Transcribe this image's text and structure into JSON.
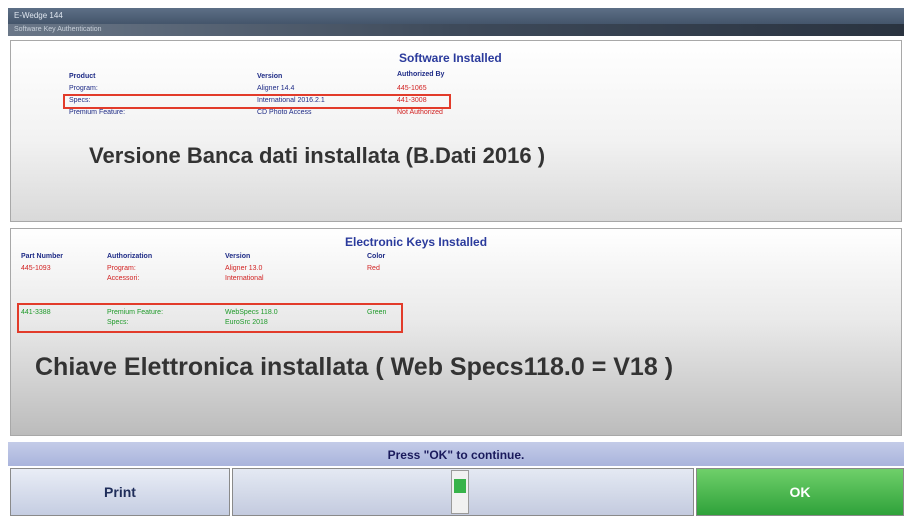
{
  "window": {
    "title": "E-Wedge 144",
    "subtitle": "Software Key Authentication"
  },
  "software": {
    "section_title": "Software Installed",
    "headers": {
      "product": "Product",
      "version": "Version",
      "authorized_by": "Authorized By"
    },
    "rows": [
      {
        "product": "Program:",
        "version": "Aligner 14.4",
        "authorized_by": "445-1065"
      },
      {
        "product": "Specs:",
        "version": "International 2016.2.1",
        "authorized_by": "441-3008"
      },
      {
        "product": "Premium Feature:",
        "version": "CD Photo Access",
        "authorized_by": "Not Authorized"
      }
    ]
  },
  "annotation_db": "Versione  Banca dati installata (B.Dati 2016 )",
  "keys": {
    "section_title": "Electronic Keys Installed",
    "headers": {
      "part": "Part Number",
      "auth": "Authorization",
      "version": "Version",
      "color": "Color"
    },
    "rows": [
      {
        "part": "445-1093",
        "auth": [
          "Program:",
          "Accessori:"
        ],
        "version": [
          "Aligner 13.0",
          "International"
        ],
        "color": "Red"
      },
      {
        "part": "441-3388",
        "auth": [
          "Premium Feature:",
          "Specs:"
        ],
        "version": [
          "WebSpecs 118.0",
          "EuroSrc 2018"
        ],
        "color": "Green"
      }
    ]
  },
  "annotation_key": "Chiave Elettronica installata ( Web Specs118.0  =  V18  )",
  "status": {
    "text": "Press \"OK\" to continue."
  },
  "buttons": {
    "print": "Print",
    "ok": "OK"
  },
  "colors": {
    "accent_blue": "#2a3a9c",
    "red": "#d22323",
    "green": "#1f9a2a",
    "ok_button": "#2fa23a",
    "highlight_box": "#e23b2a"
  }
}
